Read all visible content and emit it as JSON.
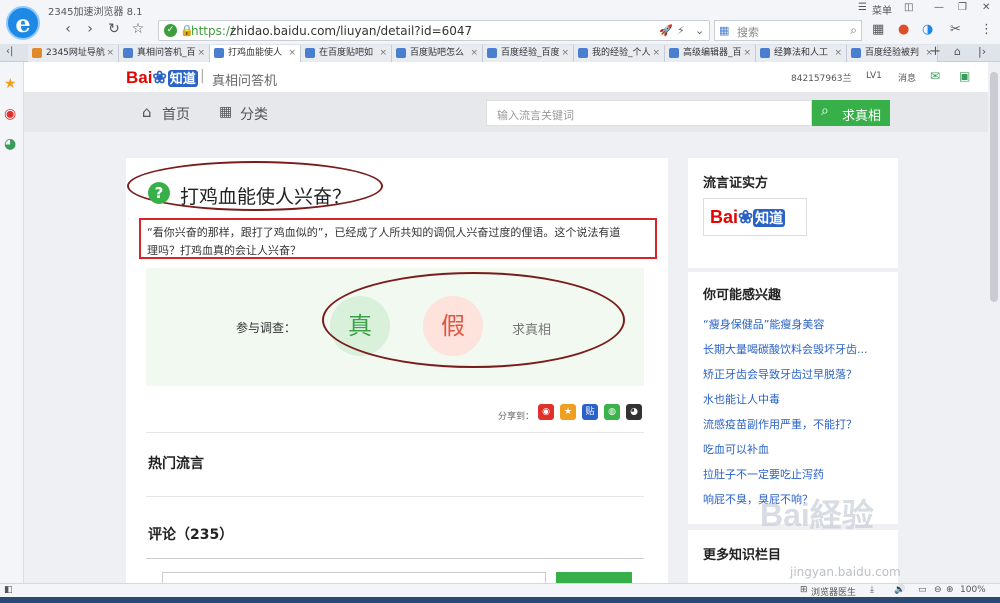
{
  "browser": {
    "app_title": "2345加速浏览器 8.1",
    "url_https": "https://",
    "url_rest": "zhidao.baidu.com/liuyan/detail?id=6047",
    "search_placeholder": "搜索",
    "menu_label": "菜单",
    "tabs": [
      {
        "label": "2345网址导航"
      },
      {
        "label": "真相问答机_百"
      },
      {
        "label": "打鸡血能使人"
      },
      {
        "label": "在百度贴吧如"
      },
      {
        "label": "百度贴吧怎么"
      },
      {
        "label": "百度经验_百度"
      },
      {
        "label": "我的经验_个人"
      },
      {
        "label": "高级编辑器_百"
      },
      {
        "label": "经算法和人工"
      },
      {
        "label": "百度经验被判"
      }
    ],
    "status": {
      "doctor": "浏览器医生",
      "zoom": "100%"
    }
  },
  "site": {
    "logo_text": "Bai",
    "logo_du": "du",
    "logo_zd": "知道",
    "subtitle": "真相问答机",
    "user": "842157963兰",
    "level": "LV1",
    "messages": "消息"
  },
  "nav": {
    "home": "首页",
    "category": "分类",
    "search_placeholder": "输入流言关键词",
    "search_button": "求真相"
  },
  "question": {
    "title": "打鸡血能使人兴奋？",
    "description_line1": "“看你兴奋的那样，跟打了鸡血似的”，已经成了人所共知的调侃人兴奋过度的俚语。这个说法有道",
    "description_line2": "理吗？打鸡血真的会让人兴奋？",
    "survey_label": "参与调查：",
    "true_label": "真",
    "false_label": "假",
    "seek_label": "求真相",
    "share_label": "分享到："
  },
  "sections": {
    "hot": "热门流言",
    "comments": "评论（235）"
  },
  "right": {
    "verifier_title": "流言证实方",
    "interest_title": "你可能感兴趣",
    "interest_items": [
      "“瘦身保健品”能瘦身美容",
      "长期大量喝碳酸饮料会毁坏牙齿...",
      "矫正牙齿会导致牙齿过早脱落？",
      "水也能让人中毒",
      "流感疫苗副作用严重，不能打？",
      "吃血可以补血",
      "拉肚子不一定要吃止泻药",
      "响屁不臭，臭屁不响？"
    ],
    "more_title": "更多知识栏目"
  },
  "watermark": {
    "text": "Bai経验",
    "url": "jingyan.baidu.com"
  },
  "colors": {
    "brand_red": "#e10602",
    "brand_blue": "#2b62c7",
    "green": "#38b04a",
    "annotation": "#7a1c1c"
  }
}
